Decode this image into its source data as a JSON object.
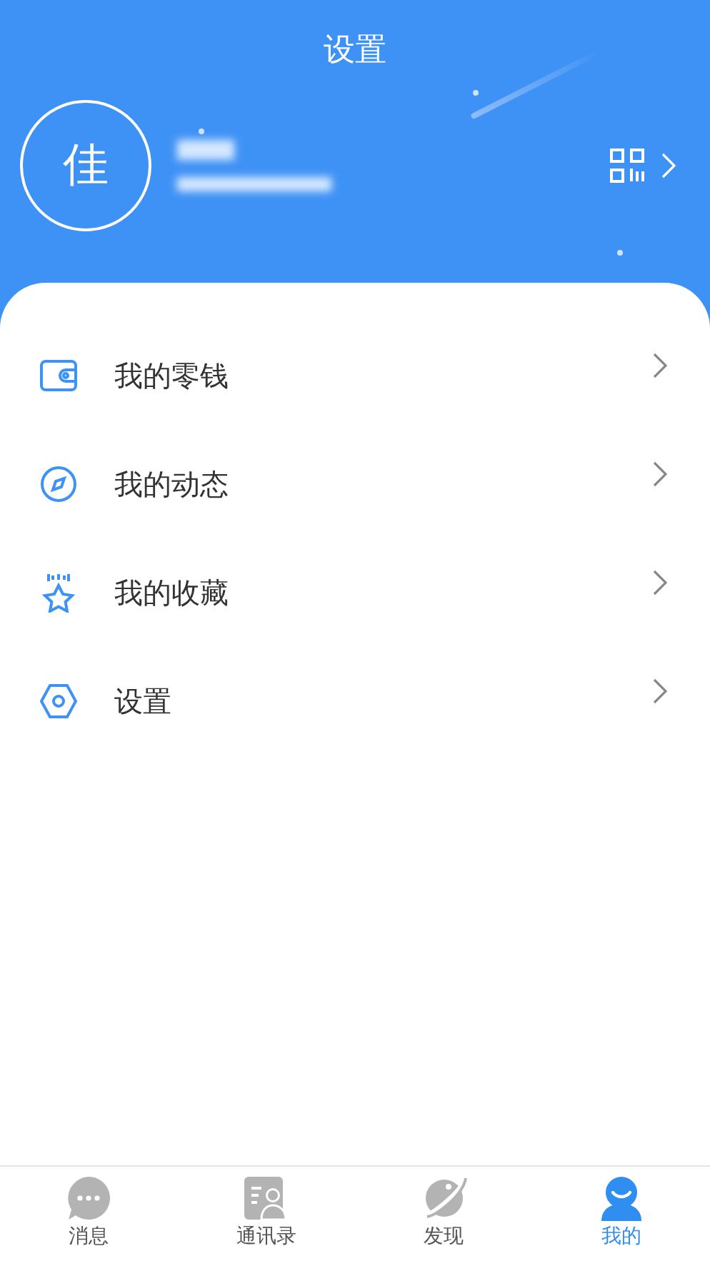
{
  "header": {
    "title": "设置",
    "avatar_text": "佳"
  },
  "menu": [
    {
      "label": "我的零钱"
    },
    {
      "label": "我的动态"
    },
    {
      "label": "我的收藏"
    },
    {
      "label": "设置"
    }
  ],
  "tabs": [
    {
      "label": "消息",
      "selected": false
    },
    {
      "label": "通讯录",
      "selected": false
    },
    {
      "label": "发现",
      "selected": false
    },
    {
      "label": "我的",
      "selected": true
    }
  ]
}
